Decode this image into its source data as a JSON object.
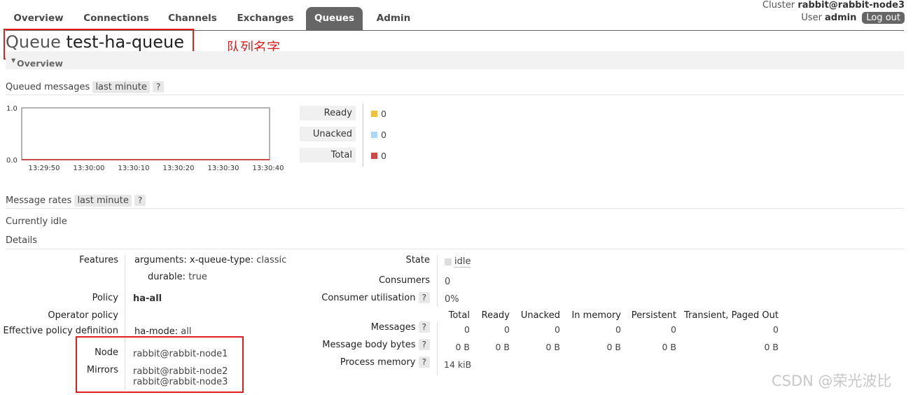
{
  "nav": {
    "tabs": [
      {
        "label": "Overview",
        "active": false
      },
      {
        "label": "Connections",
        "active": false
      },
      {
        "label": "Channels",
        "active": false
      },
      {
        "label": "Exchanges",
        "active": false
      },
      {
        "label": "Queues",
        "active": true
      },
      {
        "label": "Admin",
        "active": false
      }
    ],
    "cluster_label": "Cluster",
    "cluster_name": "rabbit@rabbit-node3",
    "user_label": "User",
    "user_name": "admin",
    "logout_label": "Log out"
  },
  "title": {
    "prefix": "Queue",
    "name": "test-ha-queue"
  },
  "annotation": "队列名字",
  "overview_section": "Overview",
  "queued_messages": {
    "label": "Queued messages",
    "range": "last minute",
    "help": "?",
    "chart_data": {
      "type": "line",
      "x": [
        "13:29:50",
        "13:30:00",
        "13:30:10",
        "13:30:20",
        "13:30:30",
        "13:30:40"
      ],
      "y_ticks": [
        "1.0",
        "0.0"
      ],
      "ylim": [
        0,
        1
      ],
      "series": [
        {
          "name": "Ready",
          "values": [
            0,
            0,
            0,
            0,
            0,
            0
          ],
          "color": "#edc240"
        },
        {
          "name": "Unacked",
          "values": [
            0,
            0,
            0,
            0,
            0,
            0
          ],
          "color": "#afd8f8"
        },
        {
          "name": "Total",
          "values": [
            0,
            0,
            0,
            0,
            0,
            0
          ],
          "color": "#cb4b4b"
        }
      ]
    },
    "legend": [
      {
        "label": "Ready",
        "value": "0",
        "color": "#edc240"
      },
      {
        "label": "Unacked",
        "value": "0",
        "color": "#afd8f8"
      },
      {
        "label": "Total",
        "value": "0",
        "color": "#cb4b4b"
      }
    ]
  },
  "message_rates": {
    "label": "Message rates",
    "range": "last minute",
    "help": "?",
    "status": "Currently idle"
  },
  "details": {
    "label": "Details",
    "features_label": "Features",
    "arguments_key": "arguments:",
    "queue_type_key": "x-queue-type:",
    "queue_type_val": "classic",
    "durable_key": "durable:",
    "durable_val": "true",
    "policy_label": "Policy",
    "policy_val": "ha-all",
    "operator_policy_label": "Operator policy",
    "effective_policy_label": "Effective policy definition",
    "ha_mode_key": "ha-mode:",
    "ha_mode_val": "all",
    "node_label": "Node",
    "node_val": "rabbit@rabbit-node1",
    "mirrors_label": "Mirrors",
    "mirrors": [
      "rabbit@rabbit-node2",
      "rabbit@rabbit-node3"
    ],
    "state_label": "State",
    "state_val": "idle",
    "consumers_label": "Consumers",
    "consumers_val": "0",
    "consumer_util_label": "Consumer utilisation",
    "consumer_util_val": "0%",
    "help": "?",
    "stats_headers": [
      "Total",
      "Ready",
      "Unacked",
      "In memory",
      "Persistent",
      "Transient, Paged Out"
    ],
    "stats_rows": [
      {
        "label": "Messages",
        "values": [
          "0",
          "0",
          "0",
          "0",
          "0",
          "0"
        ]
      },
      {
        "label": "Message body bytes",
        "values": [
          "0 B",
          "0 B",
          "0 B",
          "0 B",
          "0 B",
          "0 B"
        ]
      }
    ],
    "process_memory_label": "Process memory",
    "process_memory_val": "14 kiB"
  },
  "watermark": "CSDN @荣光波比"
}
